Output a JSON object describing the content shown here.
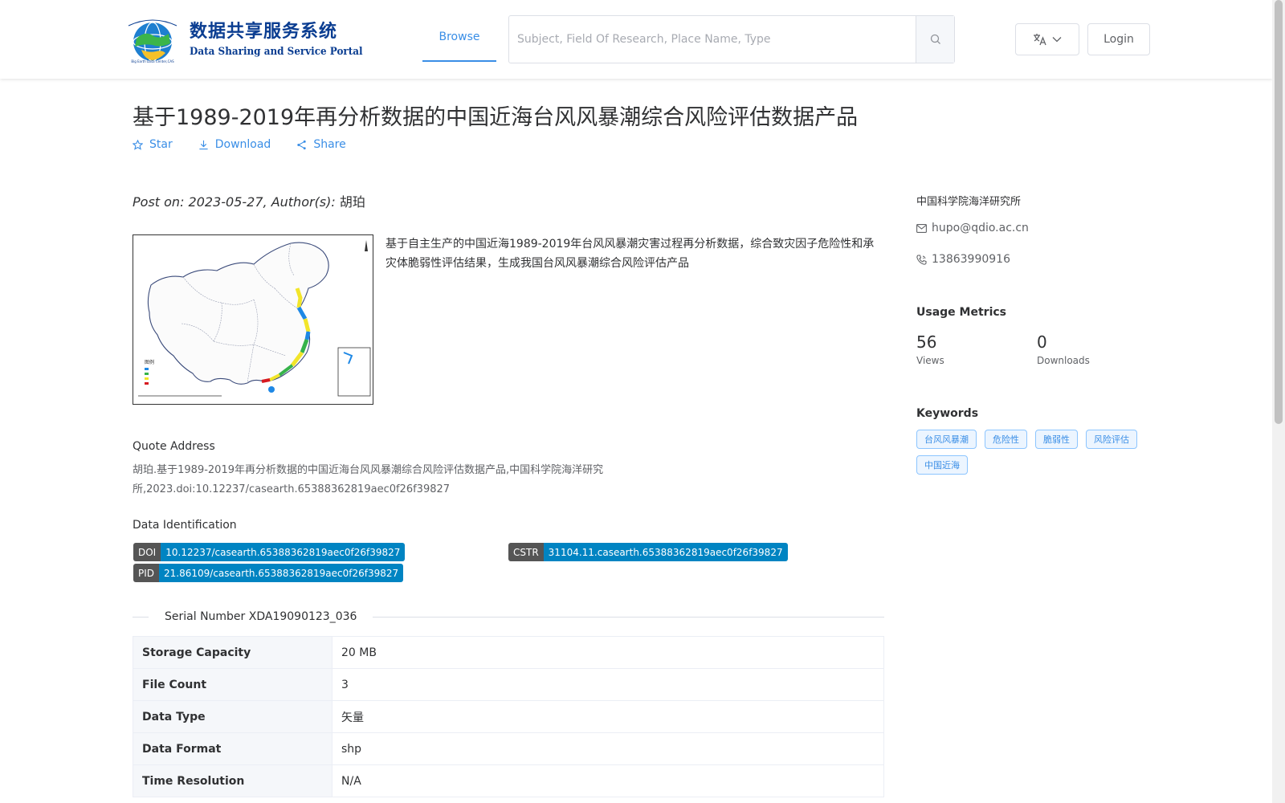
{
  "header": {
    "logo_cn": "数据共享服务系统",
    "logo_en": "Data Sharing and Service Portal",
    "nav_browse": "Browse",
    "search_placeholder": "Subject, Field Of Research, Place Name, Type",
    "login_label": "Login"
  },
  "dataset": {
    "title": "基于1989-2019年再分析数据的中国近海台风风暴潮综合风险评估数据产品",
    "actions": {
      "star": "Star",
      "download": "Download",
      "share": "Share"
    },
    "post_prefix": "Post on: 2023-05-27, Author(s):",
    "author": "胡珀",
    "description": "基于自主生产的中国近海1989-2019年台风风暴潮灾害过程再分析数据，综合致灾因子危险性和承灾体脆弱性评估结果，生成我国台风风暴潮综合风险评估产品",
    "quote_label": "Quote Address",
    "quote_text": "胡珀.基于1989-2019年再分析数据的中国近海台风风暴潮综合风险评估数据产品,中国科学院海洋研究所,2023.doi:10.12237/casearth.65388362819aec0f26f39827",
    "identification_label": "Data Identification",
    "identifiers": {
      "doi_key": "DOI",
      "doi_val": "10.12237/casearth.65388362819aec0f26f39827",
      "cstr_key": "CSTR",
      "cstr_val": "31104.11.casearth.65388362819aec0f26f39827",
      "pid_key": "PID",
      "pid_val": "21.86109/casearth.65388362819aec0f26f39827"
    },
    "serial": "Serial Number XDA19090123_036",
    "table": [
      {
        "k": "Storage Capacity",
        "v": "20 MB"
      },
      {
        "k": "File Count",
        "v": "3"
      },
      {
        "k": "Data Type",
        "v": "矢量"
      },
      {
        "k": "Data Format",
        "v": "shp"
      },
      {
        "k": "Time Resolution",
        "v": "N/A"
      }
    ]
  },
  "sidebar": {
    "org": "中国科学院海洋研究所",
    "email": "hupo@qdio.ac.cn",
    "phone": "13863990916",
    "usage_title": "Usage Metrics",
    "views_num": "56",
    "views_label": "Views",
    "downloads_num": "0",
    "downloads_label": "Downloads",
    "keywords_title": "Keywords",
    "keywords": [
      "台风风暴潮",
      "危险性",
      "脆弱性",
      "风险评估",
      "中国近海"
    ]
  },
  "icons": {
    "star": "star-icon",
    "download": "download-icon",
    "share": "share-icon",
    "search": "search-icon",
    "translate": "translate-icon",
    "email": "email-icon",
    "phone": "phone-icon"
  },
  "colors": {
    "accent": "#3a8ee6",
    "badge_key": "#555555",
    "badge_value": "#0084c2",
    "logo": "#0a3d91"
  }
}
